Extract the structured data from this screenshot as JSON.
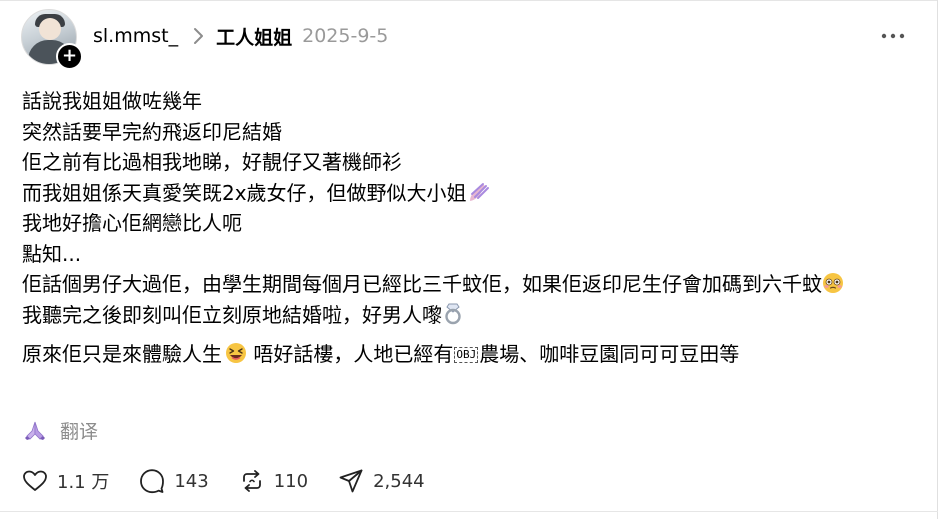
{
  "header": {
    "username": "sl.mmst_",
    "channel": "工人姐姐",
    "date": "2025-9-5"
  },
  "post": {
    "lines": [
      "話說我姐姐做咗幾年",
      "突然話要早完約飛返印尼結婚",
      "佢之前有比過相我地睇，好靚仔又著機師衫",
      "而我姐姐係天真愛笑既2x歲女仔，但做野似大小姐",
      "我地好擔心佢網戀比人呃",
      "點知...",
      "佢話個男仔大過佢，由學生期間每個月已經比三千蚊佢，如果佢返印尼生仔會加碼到六千蚊",
      "我聽完之後即刻叫佢立刻原地結婚啦，好男人嚟"
    ],
    "para2_a": "原來佢只是來體驗人生",
    "para2_b": " 唔好話樓，人地已經有",
    "obj_label": "OBJ",
    "para2_c": "農場、咖啡豆園同可可豆田等"
  },
  "translate": {
    "label": "翻译",
    "icon": "praying-hands-icon"
  },
  "actions": {
    "like_count": "1.1 万",
    "comment_count": "143",
    "repost_count": "110",
    "share_count": "2,544"
  },
  "icons": {
    "nails": "nail-polish-icon",
    "flushed": "flushed-face-icon",
    "ring": "ring-icon",
    "laugh": "grinning-squinting-face-icon"
  },
  "colors": {
    "muted": "#9a9a9a",
    "translate": "#8c8c8c",
    "emoji_purple": "#a98adf"
  }
}
